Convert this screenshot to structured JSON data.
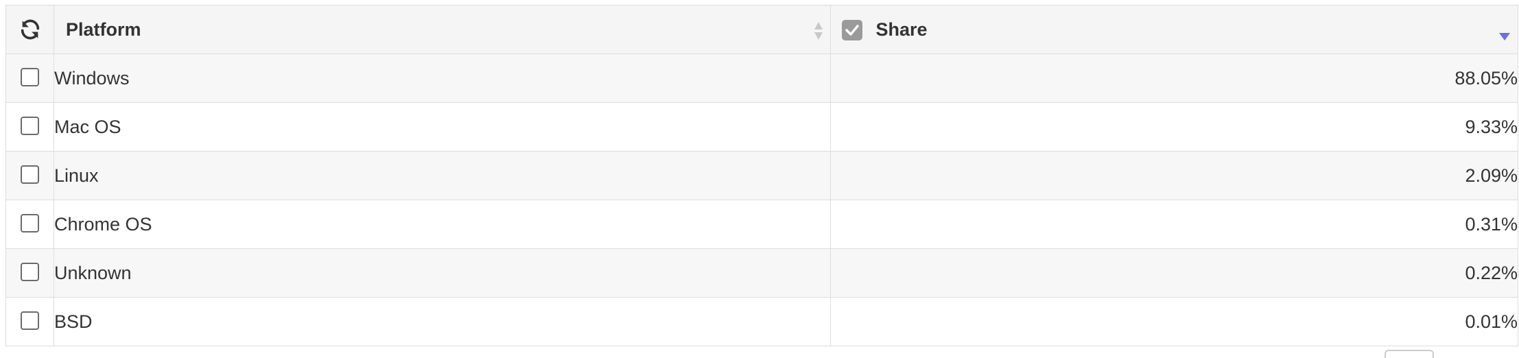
{
  "table": {
    "columns": {
      "platform": "Platform",
      "share": "Share"
    },
    "rows": [
      {
        "platform": "Windows",
        "share": "88.05%"
      },
      {
        "platform": "Mac OS",
        "share": "9.33%"
      },
      {
        "platform": "Linux",
        "share": "2.09%"
      },
      {
        "platform": "Chrome OS",
        "share": "0.31%"
      },
      {
        "platform": "Unknown",
        "share": "0.22%"
      },
      {
        "platform": "BSD",
        "share": "0.01%"
      }
    ]
  },
  "icons": {
    "refresh": "refresh-icon",
    "sort_unsorted": "sort-both-icon",
    "sort_desc": "sort-desc-icon",
    "column_checked": "checkbox-checked-icon"
  },
  "colors": {
    "header_bg": "#f5f5f5",
    "row_alt_bg": "#f7f7f7",
    "border": "#dddddd",
    "sort_accent": "#6f6fe0",
    "checked_box": "#9a9a9a"
  }
}
